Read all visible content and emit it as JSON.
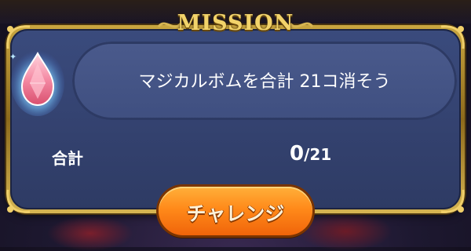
{
  "header": {
    "title": "MISSION"
  },
  "mission": {
    "description": "マジカルボムを合計 21コ消そう",
    "icon": "pink-gem-icon"
  },
  "progress": {
    "label": "合計",
    "current": "0",
    "separator": "/",
    "target": "21",
    "fraction": 0
  },
  "actions": {
    "challenge_label": "チャレンジ"
  },
  "colors": {
    "gold": "#d6b552",
    "panel": "#33416e",
    "button": "#ff8a1a"
  }
}
